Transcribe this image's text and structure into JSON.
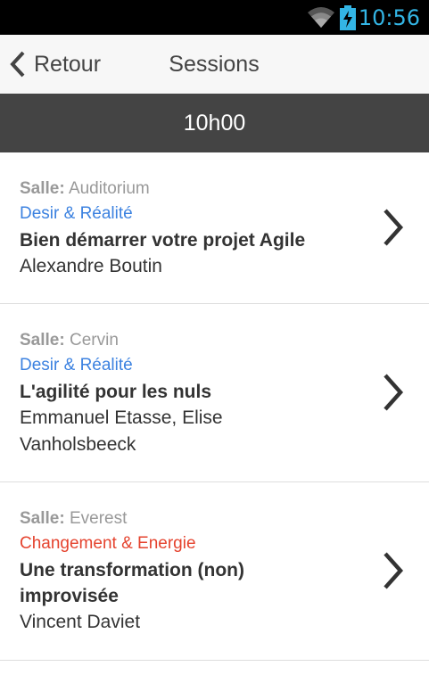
{
  "status_bar": {
    "time": "10:56",
    "icons": [
      "wifi-icon",
      "battery-charging-icon"
    ],
    "accent_color": "#33b5e5"
  },
  "nav": {
    "back_label": "Retour",
    "title": "Sessions"
  },
  "time_header": "10h00",
  "colors": {
    "blue_track": "#3c82e0",
    "red_track": "#e5432e",
    "header_bg": "#444444"
  },
  "sessions": [
    {
      "room_prefix": "Salle:",
      "room": "Auditorium",
      "track": "Desir & Réalité",
      "title_lines": [
        "Bien démarrer votre projet Agile"
      ],
      "speaker_lines": [
        "Alexandre Boutin"
      ]
    },
    {
      "room_prefix": "Salle:",
      "room": "Cervin",
      "track": "Desir & Réalité",
      "title_lines": [
        "L'agilité pour les nuls"
      ],
      "speaker_lines": [
        "Emmanuel Etasse, Elise",
        "Vanholsbeeck"
      ]
    },
    {
      "room_prefix": "Salle:",
      "room": "Everest",
      "track": "Changement & Energie",
      "title_lines": [
        "Une transformation (non)",
        "improvisée"
      ],
      "speaker_lines": [
        "Vincent Daviet"
      ]
    }
  ]
}
